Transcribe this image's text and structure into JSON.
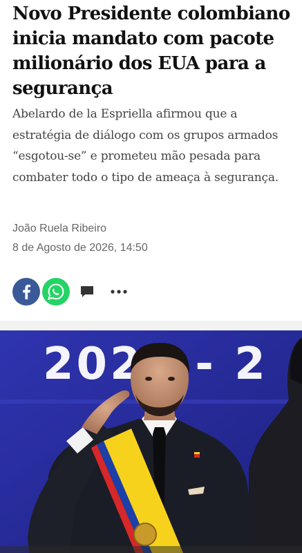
{
  "article": {
    "headline": "Novo Presidente colombiano inicia mandato com pacote milionário dos EUA para a segurança",
    "lead": "Abelardo de la Espriella afirmou que a estratégia de diálogo com os grupos armados “esgotou-se” e prometeu mão pesada para combater todo o tipo de ameaça à segurança.",
    "author": "João Ruela Ribeiro",
    "date": "8 de Agosto de 2026, 14:50"
  },
  "share": {
    "items": [
      {
        "icon": "facebook-icon",
        "color": "#3b5998"
      },
      {
        "icon": "whatsapp-icon",
        "color": "#25D366"
      },
      {
        "icon": "comment-icon",
        "color": "#333333"
      },
      {
        "icon": "more-options-icon",
        "color": "#333333"
      }
    ]
  },
  "hero_image": {
    "backdrop_text": "2026 - 2",
    "colors": {
      "backdrop": "#2b2fa3",
      "sash_yellow": "#f7d21d",
      "sash_blue": "#1c3fa8",
      "sash_red": "#d62828"
    }
  }
}
